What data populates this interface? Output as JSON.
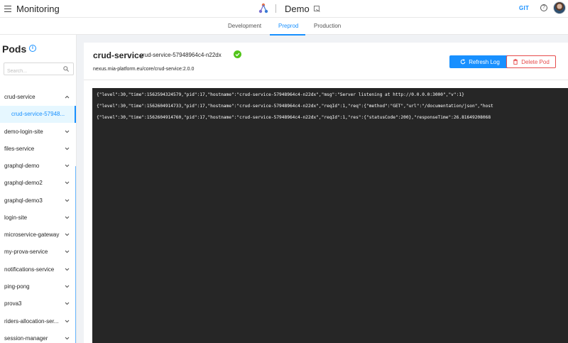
{
  "topbar": {
    "app_title": "Monitoring",
    "project_name": "Demo",
    "git_label": "GIT",
    "help_label": "?"
  },
  "tabs": [
    {
      "label": "Development",
      "active": false
    },
    {
      "label": "Preprod",
      "active": true
    },
    {
      "label": "Production",
      "active": false
    }
  ],
  "sidebar": {
    "title": "Pods",
    "search_placeholder": "Search...",
    "items": [
      {
        "label": "crud-service",
        "expanded": true
      },
      {
        "label": "crud-service-57948...",
        "sub": true
      },
      {
        "label": "demo-login-site"
      },
      {
        "label": "files-service"
      },
      {
        "label": "graphql-demo"
      },
      {
        "label": "graphql-demo2"
      },
      {
        "label": "graphql-demo3"
      },
      {
        "label": "login-site"
      },
      {
        "label": "microservice-gateway"
      },
      {
        "label": "my-prova-service"
      },
      {
        "label": "notifications-service"
      },
      {
        "label": "ping-pong"
      },
      {
        "label": "prova3"
      },
      {
        "label": "riders-allocation-ser..."
      },
      {
        "label": "session-manager"
      }
    ]
  },
  "pod": {
    "service_name": "crud-service",
    "pod_id": "crud-service-57948964c4-n22dx",
    "image": "nexus.mia-platform.eu/core/crud-service:2.0.0",
    "status_color": "#52c41a"
  },
  "actions": {
    "refresh_label": "Refresh Log",
    "delete_label": "Delete Pod"
  },
  "log_lines": [
    "{\"level\":30,\"time\":1562594324579,\"pid\":17,\"hostname\":\"crud-service-57948964c4-n22dx\",\"msg\":\"Server listening at http://0.0.0.0:3000\",\"v\":1}",
    "{\"level\":30,\"time\":1562604914733,\"pid\":17,\"hostname\":\"crud-service-57948964c4-n22dx\",\"reqId\":1,\"req\":{\"method\":\"GET\",\"url\":\"/documentation/json\",\"host",
    "{\"level\":30,\"time\":1562604914760,\"pid\":17,\"hostname\":\"crud-service-57948964c4-n22dx\",\"reqId\":1,\"res\":{\"statusCode\":200},\"responseTime\":26.81649208068"
  ],
  "colors": {
    "accent": "#1890ff",
    "danger": "#e64c4c",
    "log_bg": "#262626"
  }
}
